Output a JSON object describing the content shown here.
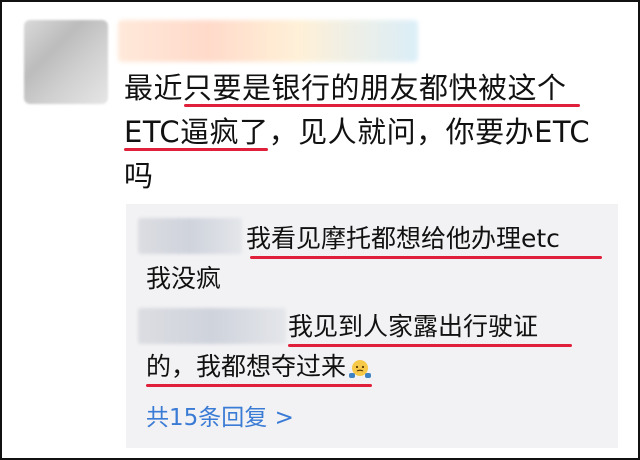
{
  "post": {
    "text_line1": "最近只要是银行的朋友都快被这个",
    "text_line2": "ETC逼疯了，见人就问，你要办ETC",
    "text_line3": "吗"
  },
  "replies": [
    {
      "line1": "我看见摩托都想给他办理etc",
      "line2": "我没疯"
    },
    {
      "line1": "我见到人家露出行驶证",
      "line2": "的，我都想夺过来"
    }
  ],
  "more_replies_label": "共15条回复 >",
  "colors": {
    "underline": "#e0203a",
    "link": "#3a7bd5",
    "reply_bg": "#f2f2f4"
  },
  "icons": {
    "emoji": "shrug-face-icon"
  }
}
